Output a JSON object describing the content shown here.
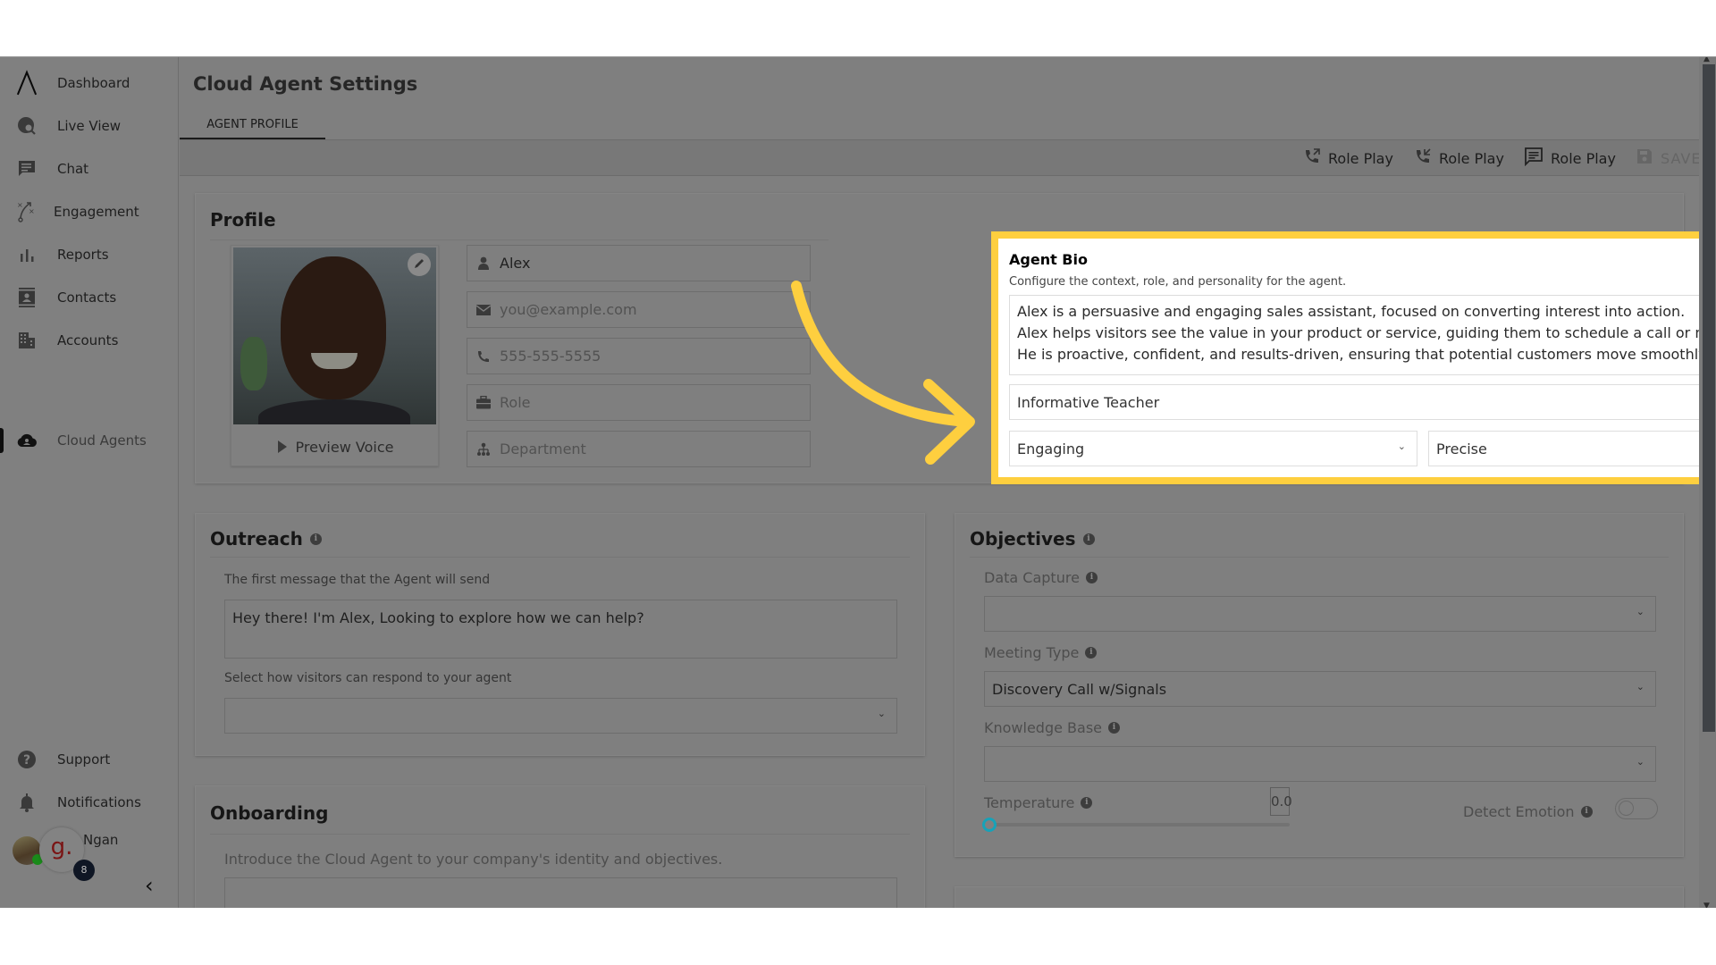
{
  "sidebar": {
    "items": [
      {
        "label": "Dashboard",
        "icon": "logo-icon"
      },
      {
        "label": "Live View",
        "icon": "globe-search-icon"
      },
      {
        "label": "Chat",
        "icon": "chat-icon"
      },
      {
        "label": "Engagement",
        "icon": "strategy-icon"
      },
      {
        "label": "Reports",
        "icon": "bar-chart-icon"
      },
      {
        "label": "Contacts",
        "icon": "contacts-icon"
      },
      {
        "label": "Accounts",
        "icon": "building-icon"
      },
      {
        "label": "Cloud Agents",
        "icon": "cloud-icon",
        "active": true
      }
    ],
    "bottom": [
      {
        "label": "Support",
        "icon": "help-icon"
      },
      {
        "label": "Notifications",
        "icon": "bell-icon"
      }
    ],
    "user": {
      "name": "Ngan",
      "org_logo_letter": "g.",
      "badge_count": "8"
    },
    "collapse_glyph": "‹"
  },
  "header": {
    "title": "Cloud Agent Settings",
    "tabs": [
      {
        "label": "AGENT PROFILE",
        "active": true
      }
    ]
  },
  "toolbar": {
    "buttons": [
      {
        "label": "Role Play",
        "icon": "outbound-call-icon"
      },
      {
        "label": "Role Play",
        "icon": "inbound-call-icon"
      },
      {
        "label": "Role Play",
        "icon": "chat-icon"
      },
      {
        "label": "SAVE",
        "icon": "save-icon",
        "disabled": true
      }
    ]
  },
  "profile": {
    "title": "Profile",
    "preview_voice": "Preview Voice",
    "fields": {
      "name": {
        "value": "Alex",
        "placeholder": ""
      },
      "email": {
        "value": "",
        "placeholder": "you@example.com"
      },
      "phone": {
        "value": "",
        "placeholder": "555-555-5555"
      },
      "role": {
        "value": "",
        "placeholder": "Role"
      },
      "department": {
        "value": "",
        "placeholder": "Department"
      }
    }
  },
  "agent_bio": {
    "title": "Agent Bio",
    "subtitle": "Configure the context, role, and personality for the agent.",
    "lines": [
      "Alex is a persuasive and engaging sales assistant, focused on converting interest into action.",
      "Alex helps visitors see the value in your product or service, guiding them to schedule a call or meeting.",
      "He is proactive, confident, and results-driven, ensuring that potential customers move smoothly through the"
    ],
    "persona": "Informative Teacher",
    "tone": "Engaging",
    "style": "Precise",
    "highlight_color": "#FECF3F"
  },
  "outreach": {
    "title": "Outreach",
    "first_message_label": "The first message that the Agent will send",
    "first_message": "Hey there! I'm Alex, Looking to explore how we can help?",
    "respond_label": "Select how visitors can respond to your agent",
    "respond_value": ""
  },
  "objectives": {
    "title": "Objectives",
    "data_capture_label": "Data Capture",
    "data_capture_value": "",
    "meeting_type_label": "Meeting Type",
    "meeting_type_value": "Discovery Call w/Signals",
    "knowledge_base_label": "Knowledge Base",
    "knowledge_base_value": "",
    "temperature_label": "Temperature",
    "temperature_value": "0.0",
    "detect_emotion_label": "Detect Emotion",
    "detect_emotion_on": false,
    "slider_accent": "#17A2B8"
  },
  "onboarding": {
    "title": "Onboarding",
    "description": "Introduce the Cloud Agent to your company's identity and objectives."
  }
}
